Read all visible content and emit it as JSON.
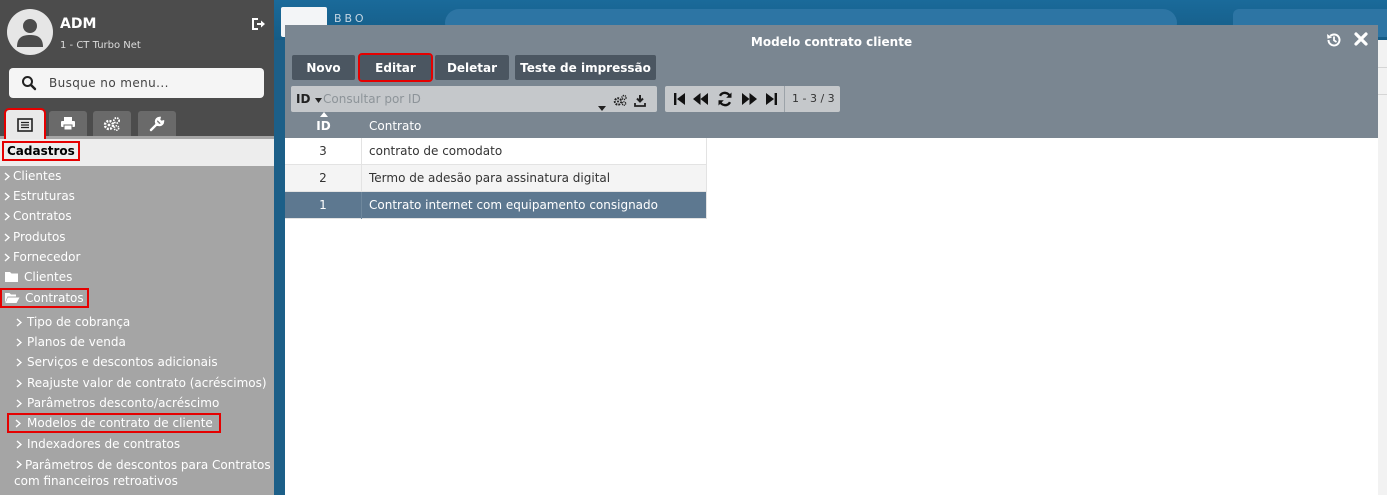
{
  "background": {
    "brand_text": "BBO"
  },
  "sidebar": {
    "user": {
      "name": "ADM",
      "subtitle": "1 - CT Turbo Net"
    },
    "search": {
      "placeholder": "Busque no menu..."
    },
    "section_title": "Cadastros",
    "top_items": [
      {
        "label": "Clientes"
      },
      {
        "label": "Estruturas"
      },
      {
        "label": "Contratos"
      },
      {
        "label": "Produtos"
      },
      {
        "label": "Fornecedor"
      }
    ],
    "folders": [
      {
        "label": "Clientes"
      },
      {
        "label": "Contratos"
      }
    ],
    "sub_items": [
      {
        "label": "Tipo de cobrança"
      },
      {
        "label": "Planos de venda"
      },
      {
        "label": "Serviços e descontos adicionais"
      },
      {
        "label": "Reajuste valor de contrato (acréscimos)"
      },
      {
        "label": "Parâmetros desconto/acréscimo"
      },
      {
        "label": "Modelos de contrato de cliente"
      },
      {
        "label": "Indexadores de contratos"
      },
      {
        "label": "Parâmetros de descontos para Contratos com financeiros retroativos"
      }
    ]
  },
  "modal": {
    "title": "Modelo contrato cliente",
    "toolbar": {
      "novo": "Novo",
      "editar": "Editar",
      "deletar": "Deletar",
      "teste": "Teste de impressão"
    },
    "filter": {
      "field": "ID",
      "placeholder": "Consultar por ID"
    },
    "pager": {
      "count": "1 - 3 / 3"
    },
    "columns": {
      "id": "ID",
      "contrato": "Contrato"
    },
    "rows": [
      {
        "id": "3",
        "contrato": "contrato de comodato"
      },
      {
        "id": "2",
        "contrato": "Termo de adesão para assinatura digital"
      },
      {
        "id": "1",
        "contrato": "Contrato internet com equipamento consignado"
      }
    ]
  },
  "colors": {
    "sidebar_header": "#4c4c4c",
    "sidebar_body": "#a5a5a5",
    "modal_header": "#7a8691",
    "toolbar_button": "#4b5661",
    "selected_row": "#5d7890",
    "highlight": "#e50000"
  }
}
